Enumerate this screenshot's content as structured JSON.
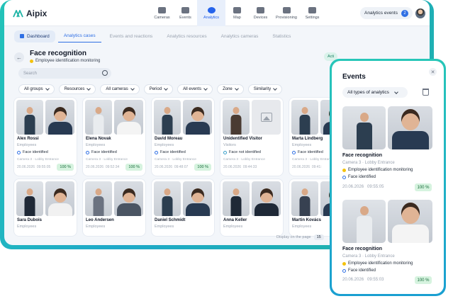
{
  "app": {
    "logo": "Aipix"
  },
  "nav": [
    {
      "label": "Cameras",
      "icon": "camera-icon"
    },
    {
      "label": "Events",
      "icon": "calendar-icon"
    },
    {
      "label": "Analytics",
      "icon": "chart-icon",
      "active": true
    },
    {
      "label": "Map",
      "icon": "map-pin-icon"
    },
    {
      "label": "Devices",
      "icon": "monitor-icon"
    },
    {
      "label": "Provisioning",
      "icon": "provisioning-icon"
    },
    {
      "label": "Settings",
      "icon": "gear-icon"
    }
  ],
  "header": {
    "events_button": "Analytics events",
    "events_count": "2"
  },
  "tabs": [
    "Dashboard",
    "Analytics cases",
    "Events and reactions",
    "Analytics resources",
    "Analytics cameras",
    "Statistics"
  ],
  "page": {
    "title": "Face recognition",
    "subtitle": "Employee identification monitoring",
    "status_chip": "Acti"
  },
  "search": {
    "placeholder": "Search"
  },
  "filters": [
    "All groups",
    "Resources",
    "All cameras",
    "Period",
    "All events",
    "Zone",
    "Similarity"
  ],
  "cards": [
    {
      "name": "Alex Rossi",
      "role": "Employees",
      "status": "Face identified",
      "camera": "Camera 3 · Lobby Entrance",
      "date": "20.06.2026",
      "time": "09:55:05",
      "pct": "100 %"
    },
    {
      "name": "Elena Novak",
      "role": "Employees",
      "status": "Face identified",
      "camera": "Camera 3 · Lobby Entrance",
      "date": "20.06.2026",
      "time": "09:52:34",
      "pct": "100 %"
    },
    {
      "name": "David Moreau",
      "role": "Employees",
      "status": "Face identified",
      "camera": "Camera 3 · Lobby Entrance",
      "date": "20.06.2026",
      "time": "09:48:07",
      "pct": "100 %"
    },
    {
      "name": "Unidentified Visitor",
      "role": "Visitors",
      "status": "Face not identified",
      "camera": "Camera 3 · Lobby Entrance",
      "date": "20.06.2026",
      "time": "09:44:33",
      "pct": ""
    },
    {
      "name": "Marta Lindberg",
      "role": "Employees",
      "status": "Face identified",
      "camera": "Camera 3 · Lobby Entrance",
      "date": "20.06.2026",
      "time": "09:41:",
      "pct": "100"
    },
    {
      "name": "Sara Dubois",
      "role": "Employees"
    },
    {
      "name": "Leo Andersen",
      "role": "Employees"
    },
    {
      "name": "Daniel Schmidt",
      "role": "Employees"
    },
    {
      "name": "Anna Keller",
      "role": "Employees"
    },
    {
      "name": "Martin Kovács",
      "role": "Employees"
    }
  ],
  "paging": {
    "label": "Display on the page",
    "value": "15"
  },
  "events_panel": {
    "title": "Events",
    "filter": "All types of analytics",
    "items": [
      {
        "title": "Face recognition",
        "camera": "Camera 3 · Lobby Entrance",
        "case": "Employee identification monitoring",
        "status": "Face identified",
        "date": "20.06.2026",
        "time": "09:55:05",
        "pct": "100 %"
      },
      {
        "title": "Face recognition",
        "camera": "Camera 3 · Lobby Entrance",
        "case": "Employee identification monitoring",
        "status": "Face identified",
        "date": "20.06.2026",
        "time": "09:55:03",
        "pct": "100 %"
      }
    ]
  },
  "colors": {
    "accent": "#2f6fe4",
    "frame_gradient_start": "#23c3b8",
    "frame_gradient_end": "#1a9fd1",
    "success_bg": "#d6f3df"
  }
}
